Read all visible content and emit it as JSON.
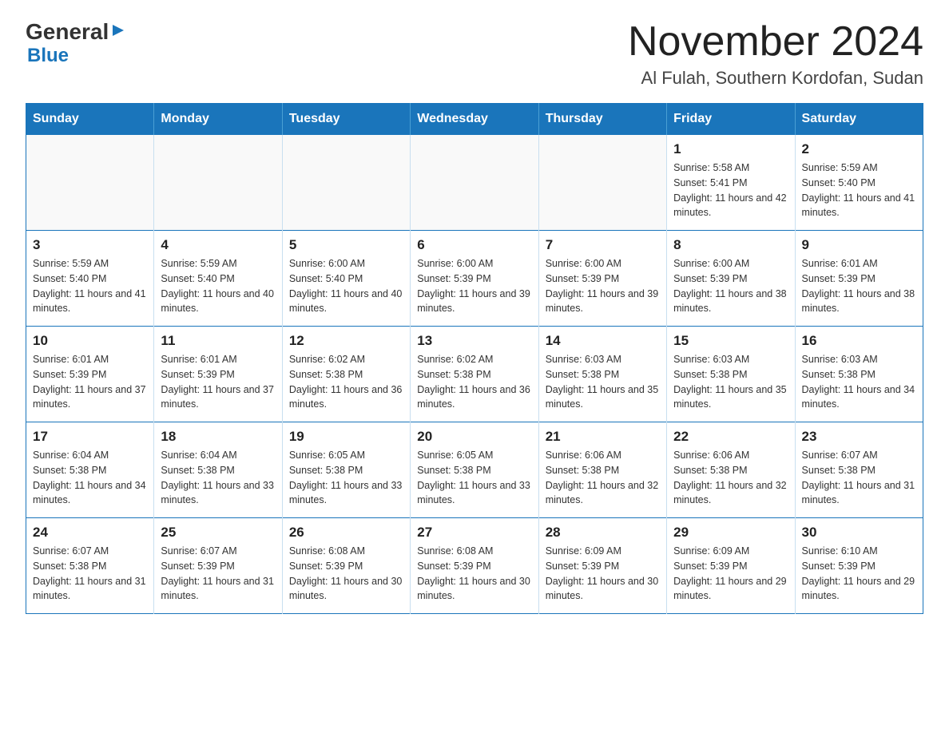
{
  "logo": {
    "general": "General",
    "blue": "Blue"
  },
  "title": {
    "month": "November 2024",
    "location": "Al Fulah, Southern Kordofan, Sudan"
  },
  "days_of_week": [
    "Sunday",
    "Monday",
    "Tuesday",
    "Wednesday",
    "Thursday",
    "Friday",
    "Saturday"
  ],
  "weeks": [
    [
      {
        "day": "",
        "info": ""
      },
      {
        "day": "",
        "info": ""
      },
      {
        "day": "",
        "info": ""
      },
      {
        "day": "",
        "info": ""
      },
      {
        "day": "",
        "info": ""
      },
      {
        "day": "1",
        "info": "Sunrise: 5:58 AM\nSunset: 5:41 PM\nDaylight: 11 hours and 42 minutes."
      },
      {
        "day": "2",
        "info": "Sunrise: 5:59 AM\nSunset: 5:40 PM\nDaylight: 11 hours and 41 minutes."
      }
    ],
    [
      {
        "day": "3",
        "info": "Sunrise: 5:59 AM\nSunset: 5:40 PM\nDaylight: 11 hours and 41 minutes."
      },
      {
        "day": "4",
        "info": "Sunrise: 5:59 AM\nSunset: 5:40 PM\nDaylight: 11 hours and 40 minutes."
      },
      {
        "day": "5",
        "info": "Sunrise: 6:00 AM\nSunset: 5:40 PM\nDaylight: 11 hours and 40 minutes."
      },
      {
        "day": "6",
        "info": "Sunrise: 6:00 AM\nSunset: 5:39 PM\nDaylight: 11 hours and 39 minutes."
      },
      {
        "day": "7",
        "info": "Sunrise: 6:00 AM\nSunset: 5:39 PM\nDaylight: 11 hours and 39 minutes."
      },
      {
        "day": "8",
        "info": "Sunrise: 6:00 AM\nSunset: 5:39 PM\nDaylight: 11 hours and 38 minutes."
      },
      {
        "day": "9",
        "info": "Sunrise: 6:01 AM\nSunset: 5:39 PM\nDaylight: 11 hours and 38 minutes."
      }
    ],
    [
      {
        "day": "10",
        "info": "Sunrise: 6:01 AM\nSunset: 5:39 PM\nDaylight: 11 hours and 37 minutes."
      },
      {
        "day": "11",
        "info": "Sunrise: 6:01 AM\nSunset: 5:39 PM\nDaylight: 11 hours and 37 minutes."
      },
      {
        "day": "12",
        "info": "Sunrise: 6:02 AM\nSunset: 5:38 PM\nDaylight: 11 hours and 36 minutes."
      },
      {
        "day": "13",
        "info": "Sunrise: 6:02 AM\nSunset: 5:38 PM\nDaylight: 11 hours and 36 minutes."
      },
      {
        "day": "14",
        "info": "Sunrise: 6:03 AM\nSunset: 5:38 PM\nDaylight: 11 hours and 35 minutes."
      },
      {
        "day": "15",
        "info": "Sunrise: 6:03 AM\nSunset: 5:38 PM\nDaylight: 11 hours and 35 minutes."
      },
      {
        "day": "16",
        "info": "Sunrise: 6:03 AM\nSunset: 5:38 PM\nDaylight: 11 hours and 34 minutes."
      }
    ],
    [
      {
        "day": "17",
        "info": "Sunrise: 6:04 AM\nSunset: 5:38 PM\nDaylight: 11 hours and 34 minutes."
      },
      {
        "day": "18",
        "info": "Sunrise: 6:04 AM\nSunset: 5:38 PM\nDaylight: 11 hours and 33 minutes."
      },
      {
        "day": "19",
        "info": "Sunrise: 6:05 AM\nSunset: 5:38 PM\nDaylight: 11 hours and 33 minutes."
      },
      {
        "day": "20",
        "info": "Sunrise: 6:05 AM\nSunset: 5:38 PM\nDaylight: 11 hours and 33 minutes."
      },
      {
        "day": "21",
        "info": "Sunrise: 6:06 AM\nSunset: 5:38 PM\nDaylight: 11 hours and 32 minutes."
      },
      {
        "day": "22",
        "info": "Sunrise: 6:06 AM\nSunset: 5:38 PM\nDaylight: 11 hours and 32 minutes."
      },
      {
        "day": "23",
        "info": "Sunrise: 6:07 AM\nSunset: 5:38 PM\nDaylight: 11 hours and 31 minutes."
      }
    ],
    [
      {
        "day": "24",
        "info": "Sunrise: 6:07 AM\nSunset: 5:38 PM\nDaylight: 11 hours and 31 minutes."
      },
      {
        "day": "25",
        "info": "Sunrise: 6:07 AM\nSunset: 5:39 PM\nDaylight: 11 hours and 31 minutes."
      },
      {
        "day": "26",
        "info": "Sunrise: 6:08 AM\nSunset: 5:39 PM\nDaylight: 11 hours and 30 minutes."
      },
      {
        "day": "27",
        "info": "Sunrise: 6:08 AM\nSunset: 5:39 PM\nDaylight: 11 hours and 30 minutes."
      },
      {
        "day": "28",
        "info": "Sunrise: 6:09 AM\nSunset: 5:39 PM\nDaylight: 11 hours and 30 minutes."
      },
      {
        "day": "29",
        "info": "Sunrise: 6:09 AM\nSunset: 5:39 PM\nDaylight: 11 hours and 29 minutes."
      },
      {
        "day": "30",
        "info": "Sunrise: 6:10 AM\nSunset: 5:39 PM\nDaylight: 11 hours and 29 minutes."
      }
    ]
  ]
}
